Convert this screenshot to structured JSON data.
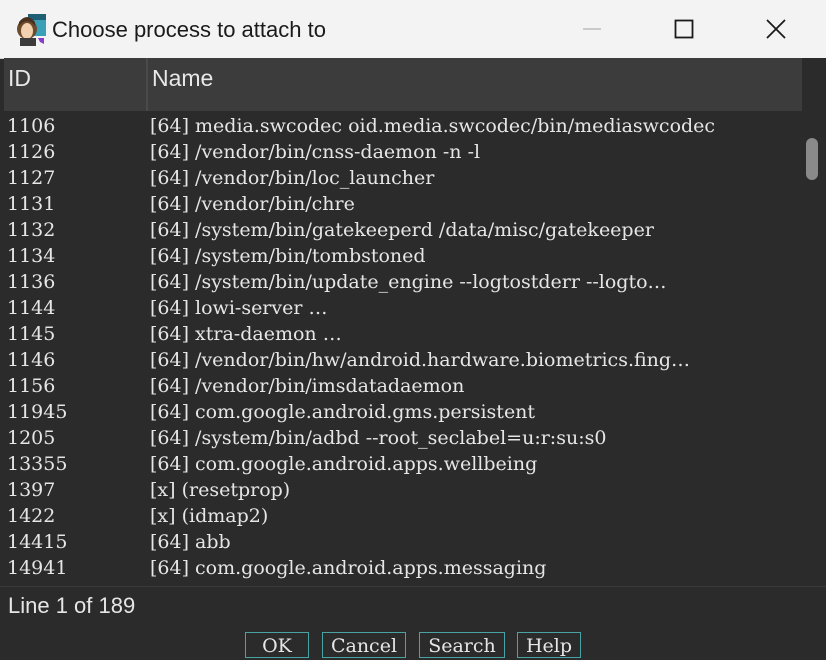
{
  "window": {
    "title": "Choose process to attach to"
  },
  "columns": {
    "id": "ID",
    "name": "Name"
  },
  "rows": [
    {
      "id": "1106",
      "name": "[64] media.swcodec oid.media.swcodec/bin/mediaswcodec"
    },
    {
      "id": "1126",
      "name": "[64] /vendor/bin/cnss-daemon -n -l"
    },
    {
      "id": "1127",
      "name": "[64] /vendor/bin/loc_launcher"
    },
    {
      "id": "1131",
      "name": "[64] /vendor/bin/chre"
    },
    {
      "id": "1132",
      "name": "[64] /system/bin/gatekeeperd /data/misc/gatekeeper"
    },
    {
      "id": "1134",
      "name": "[64] /system/bin/tombstoned"
    },
    {
      "id": "1136",
      "name": "[64] /system/bin/update_engine --logtostderr --logto…"
    },
    {
      "id": "1144",
      "name": "[64] lowi-server …"
    },
    {
      "id": "1145",
      "name": "[64] xtra-daemon …"
    },
    {
      "id": "1146",
      "name": "[64] /vendor/bin/hw/android.hardware.biometrics.fing…"
    },
    {
      "id": "1156",
      "name": "[64] /vendor/bin/imsdatadaemon"
    },
    {
      "id": "11945",
      "name": "[64] com.google.android.gms.persistent"
    },
    {
      "id": "1205",
      "name": "[64] /system/bin/adbd --root_seclabel=u:r:su:s0"
    },
    {
      "id": "13355",
      "name": "[64] com.google.android.apps.wellbeing"
    },
    {
      "id": "1397",
      "name": "[x] (resetprop)"
    },
    {
      "id": "1422",
      "name": "[x] (idmap2)"
    },
    {
      "id": "14415",
      "name": "[64] abb"
    },
    {
      "id": "14941",
      "name": "[64] com.google.android.apps.messaging"
    }
  ],
  "status": {
    "text": "Line 1 of 189"
  },
  "buttons": {
    "ok": "OK",
    "cancel": "Cancel",
    "search": "Search",
    "help": "Help"
  },
  "icons": {
    "app": "portrait-app-icon",
    "minimize": "minimize-icon",
    "maximize": "maximize-icon",
    "close": "close-icon"
  },
  "colors": {
    "background": "#2b2b2b",
    "header": "#3c3c3c",
    "titlebar": "#f3f3f3",
    "button_border": "#4aa3a3",
    "text": "#e6e6e6"
  }
}
